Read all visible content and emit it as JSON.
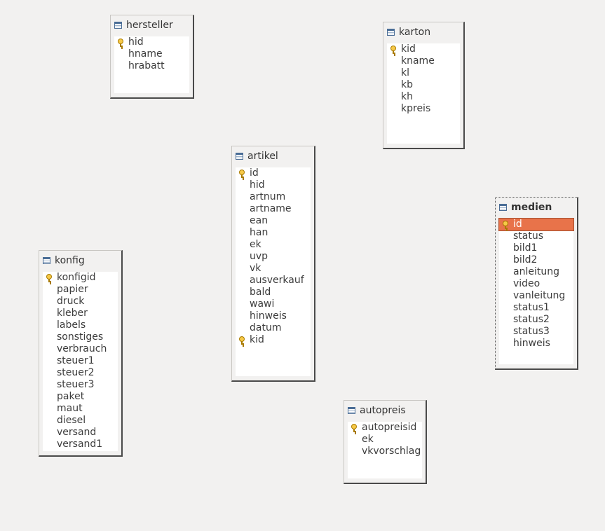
{
  "tables": {
    "hersteller": {
      "title": "hersteller",
      "fields": [
        "hid",
        "hname",
        "hrabatt"
      ]
    },
    "karton": {
      "title": "karton",
      "fields": [
        "kid",
        "kname",
        "kl",
        "kb",
        "kh",
        "kpreis"
      ]
    },
    "artikel": {
      "title": "artikel",
      "fields": [
        "id",
        "hid",
        "artnum",
        "artname",
        "ean",
        "han",
        "ek",
        "uvp",
        "vk",
        "ausverkauf",
        "bald",
        "wawi",
        "hinweis",
        "datum",
        "kid"
      ]
    },
    "medien": {
      "title": "medien",
      "fields": [
        "id",
        "status",
        "bild1",
        "bild2",
        "anleitung",
        "video",
        "vanleitung",
        "status1",
        "status2",
        "status3",
        "hinweis"
      ]
    },
    "konfig": {
      "title": "konfig",
      "fields": [
        "konfigid",
        "papier",
        "druck",
        "kleber",
        "labels",
        "sonstiges",
        "verbrauch",
        "steuer1",
        "steuer2",
        "steuer3",
        "paket",
        "maut",
        "diesel",
        "versand",
        "versand1"
      ]
    },
    "autopreis": {
      "title": "autopreis",
      "fields": [
        "autopreisid",
        "ek",
        "vkvorschlag"
      ]
    }
  },
  "colors": {
    "selection": "#e8734a",
    "canvas": "#f2f1f0"
  },
  "icons": {
    "table": "table-icon",
    "primary_key": "primary-key-icon"
  }
}
